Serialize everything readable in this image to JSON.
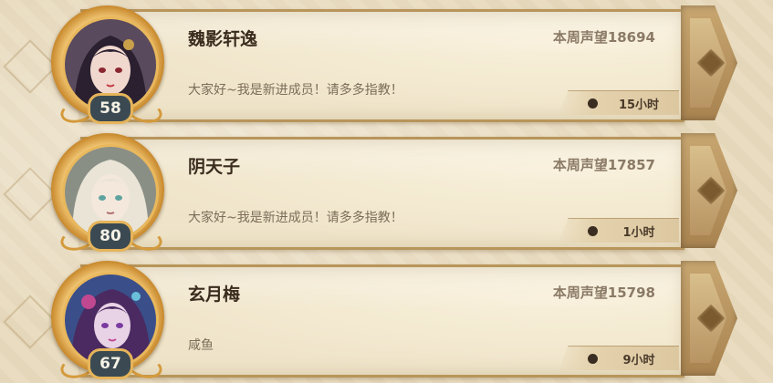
{
  "members": [
    {
      "name": "魏影轩逸",
      "level": "58",
      "reputation": "本周声望18694",
      "message": "大家好~我是新进成员！请多多指教！",
      "time": "15小时",
      "avatar_colors": {
        "bg": "#5a4a5e",
        "hair": "#2a2030",
        "skin": "#f1d8cf",
        "accent": "#c0343a"
      }
    },
    {
      "name": "阴天子",
      "level": "80",
      "reputation": "本周声望17857",
      "message": "大家好~我是新进成员！请多多指教！",
      "time": "1小时",
      "avatar_colors": {
        "bg": "#8a8f86",
        "hair": "#e9e4d6",
        "skin": "#f4e8dc",
        "accent": "#5fa3a0"
      }
    },
    {
      "name": "玄月梅",
      "level": "67",
      "reputation": "本周声望15798",
      "message": "咸鱼",
      "time": "9小时",
      "avatar_colors": {
        "bg": "#3a4f8a",
        "hair": "#4a2a60",
        "skin": "#e8d2e6",
        "accent": "#c04890"
      }
    }
  ],
  "colors": {
    "name": "#3a2c1e",
    "reputation": "#8a7a66",
    "message": "#7c6d5a",
    "level_badge": "#3b4a52",
    "frame_gold": "#e6b45a"
  }
}
